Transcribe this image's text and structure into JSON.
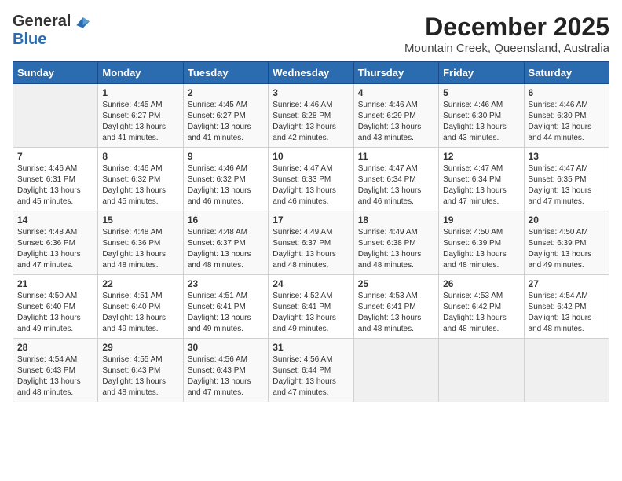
{
  "logo": {
    "general": "General",
    "blue": "Blue"
  },
  "title": "December 2025",
  "subtitle": "Mountain Creek, Queensland, Australia",
  "days_of_week": [
    "Sunday",
    "Monday",
    "Tuesday",
    "Wednesday",
    "Thursday",
    "Friday",
    "Saturday"
  ],
  "weeks": [
    [
      {
        "day": "",
        "info": ""
      },
      {
        "day": "1",
        "info": "Sunrise: 4:45 AM\nSunset: 6:27 PM\nDaylight: 13 hours\nand 41 minutes."
      },
      {
        "day": "2",
        "info": "Sunrise: 4:45 AM\nSunset: 6:27 PM\nDaylight: 13 hours\nand 41 minutes."
      },
      {
        "day": "3",
        "info": "Sunrise: 4:46 AM\nSunset: 6:28 PM\nDaylight: 13 hours\nand 42 minutes."
      },
      {
        "day": "4",
        "info": "Sunrise: 4:46 AM\nSunset: 6:29 PM\nDaylight: 13 hours\nand 43 minutes."
      },
      {
        "day": "5",
        "info": "Sunrise: 4:46 AM\nSunset: 6:30 PM\nDaylight: 13 hours\nand 43 minutes."
      },
      {
        "day": "6",
        "info": "Sunrise: 4:46 AM\nSunset: 6:30 PM\nDaylight: 13 hours\nand 44 minutes."
      }
    ],
    [
      {
        "day": "7",
        "info": "Sunrise: 4:46 AM\nSunset: 6:31 PM\nDaylight: 13 hours\nand 45 minutes."
      },
      {
        "day": "8",
        "info": "Sunrise: 4:46 AM\nSunset: 6:32 PM\nDaylight: 13 hours\nand 45 minutes."
      },
      {
        "day": "9",
        "info": "Sunrise: 4:46 AM\nSunset: 6:32 PM\nDaylight: 13 hours\nand 46 minutes."
      },
      {
        "day": "10",
        "info": "Sunrise: 4:47 AM\nSunset: 6:33 PM\nDaylight: 13 hours\nand 46 minutes."
      },
      {
        "day": "11",
        "info": "Sunrise: 4:47 AM\nSunset: 6:34 PM\nDaylight: 13 hours\nand 46 minutes."
      },
      {
        "day": "12",
        "info": "Sunrise: 4:47 AM\nSunset: 6:34 PM\nDaylight: 13 hours\nand 47 minutes."
      },
      {
        "day": "13",
        "info": "Sunrise: 4:47 AM\nSunset: 6:35 PM\nDaylight: 13 hours\nand 47 minutes."
      }
    ],
    [
      {
        "day": "14",
        "info": "Sunrise: 4:48 AM\nSunset: 6:36 PM\nDaylight: 13 hours\nand 47 minutes."
      },
      {
        "day": "15",
        "info": "Sunrise: 4:48 AM\nSunset: 6:36 PM\nDaylight: 13 hours\nand 48 minutes."
      },
      {
        "day": "16",
        "info": "Sunrise: 4:48 AM\nSunset: 6:37 PM\nDaylight: 13 hours\nand 48 minutes."
      },
      {
        "day": "17",
        "info": "Sunrise: 4:49 AM\nSunset: 6:37 PM\nDaylight: 13 hours\nand 48 minutes."
      },
      {
        "day": "18",
        "info": "Sunrise: 4:49 AM\nSunset: 6:38 PM\nDaylight: 13 hours\nand 48 minutes."
      },
      {
        "day": "19",
        "info": "Sunrise: 4:50 AM\nSunset: 6:39 PM\nDaylight: 13 hours\nand 48 minutes."
      },
      {
        "day": "20",
        "info": "Sunrise: 4:50 AM\nSunset: 6:39 PM\nDaylight: 13 hours\nand 49 minutes."
      }
    ],
    [
      {
        "day": "21",
        "info": "Sunrise: 4:50 AM\nSunset: 6:40 PM\nDaylight: 13 hours\nand 49 minutes."
      },
      {
        "day": "22",
        "info": "Sunrise: 4:51 AM\nSunset: 6:40 PM\nDaylight: 13 hours\nand 49 minutes."
      },
      {
        "day": "23",
        "info": "Sunrise: 4:51 AM\nSunset: 6:41 PM\nDaylight: 13 hours\nand 49 minutes."
      },
      {
        "day": "24",
        "info": "Sunrise: 4:52 AM\nSunset: 6:41 PM\nDaylight: 13 hours\nand 49 minutes."
      },
      {
        "day": "25",
        "info": "Sunrise: 4:53 AM\nSunset: 6:41 PM\nDaylight: 13 hours\nand 48 minutes."
      },
      {
        "day": "26",
        "info": "Sunrise: 4:53 AM\nSunset: 6:42 PM\nDaylight: 13 hours\nand 48 minutes."
      },
      {
        "day": "27",
        "info": "Sunrise: 4:54 AM\nSunset: 6:42 PM\nDaylight: 13 hours\nand 48 minutes."
      }
    ],
    [
      {
        "day": "28",
        "info": "Sunrise: 4:54 AM\nSunset: 6:43 PM\nDaylight: 13 hours\nand 48 minutes."
      },
      {
        "day": "29",
        "info": "Sunrise: 4:55 AM\nSunset: 6:43 PM\nDaylight: 13 hours\nand 48 minutes."
      },
      {
        "day": "30",
        "info": "Sunrise: 4:56 AM\nSunset: 6:43 PM\nDaylight: 13 hours\nand 47 minutes."
      },
      {
        "day": "31",
        "info": "Sunrise: 4:56 AM\nSunset: 6:44 PM\nDaylight: 13 hours\nand 47 minutes."
      },
      {
        "day": "",
        "info": ""
      },
      {
        "day": "",
        "info": ""
      },
      {
        "day": "",
        "info": ""
      }
    ]
  ]
}
